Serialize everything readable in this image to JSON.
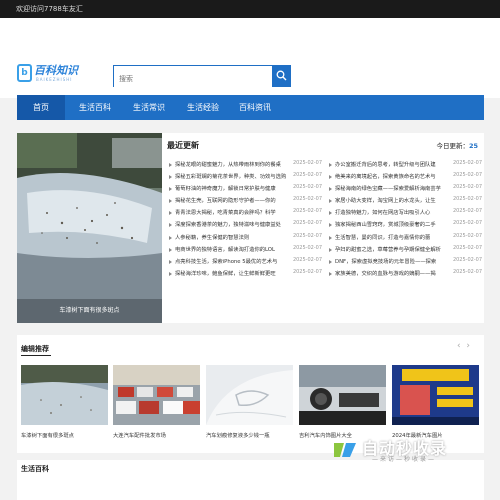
{
  "topbar": {
    "text": "欢迎访问7788车友汇"
  },
  "logo": {
    "mark": "b",
    "name": "百科知识",
    "sub": "BAIKEZHISHI"
  },
  "search": {
    "placeholder": "搜索"
  },
  "nav": [
    "首页",
    "生活百科",
    "生活常识",
    "生活经验",
    "百科资讯"
  ],
  "hero": {
    "caption": "车漆树下面有很多斑点"
  },
  "latest": {
    "title": "最近更新",
    "today_label": "今日更新：",
    "today_count": "25",
    "left": [
      {
        "t": "探秘龙眼的甜蜜魅力，从热带雨林到你的餐桌",
        "d": "2025-02-07"
      },
      {
        "t": "探秘五彩斑斓的菊花茶世界，种类、功效与选购",
        "d": "2025-02-07"
      },
      {
        "t": "葡萄籽油的神奇魔力，解锁日常护肤与健康",
        "d": "2025-02-07"
      },
      {
        "t": "揭秘花生壳，互联网的隐形守护者——你的",
        "d": "2025-02-07"
      },
      {
        "t": "青青法恩大揭秘，吃青菜真的会胖吗？科学",
        "d": "2025-02-07"
      },
      {
        "t": "深度探索香港茶的魅力，独特滋味与健康益处",
        "d": "2025-02-07"
      },
      {
        "t": "人参秘籍，养生保健的智慧法则",
        "d": "2025-02-07"
      },
      {
        "t": "电商世界的独特语言，解读淘打造你的LOL",
        "d": "2025-02-07"
      },
      {
        "t": "点亮科技生活，探索iPhone 5最优的艺术与",
        "d": "2025-02-07"
      },
      {
        "t": "探秘海洋珍味，鲍鱼保鲜，让生鲜新鲜更旺",
        "d": "2025-02-07"
      }
    ],
    "right": [
      {
        "t": "办公室搬迁背后的思考，转型升级与团队建",
        "d": "2025-02-07"
      },
      {
        "t": "绝美来的离境起名，探索黄族命名的艺术与",
        "d": "2025-02-07"
      },
      {
        "t": "探秘海南的绿色宝藏——探索爱解析海南芸芋",
        "d": "2025-02-07"
      },
      {
        "t": "家居小助大变样，淘宝网上的水龙头，让生",
        "d": "2025-02-07"
      },
      {
        "t": "打造独特魅力，如何在网店写出吸引人心",
        "d": "2025-02-07"
      },
      {
        "t": "独家揭秘西山雪窍窍，赏城顶级豪奢的二手",
        "d": "2025-02-07"
      },
      {
        "t": "生活智慧，曼的同识，打造与嘉情你的蕾",
        "d": "2025-02-07"
      },
      {
        "t": "孕妇的甜蜜之选，草莓营养与孕期保健全解析",
        "d": "2025-02-07"
      },
      {
        "t": "DNF，探索虚拟竞技场的元年冒险——探索",
        "d": "2025-02-07"
      },
      {
        "t": "家族美德，交织的血脉与游戏的嫡嗣——揭",
        "d": "2025-02-07"
      }
    ]
  },
  "recommend": {
    "title": "编辑推荐",
    "items": [
      "车漆树下面有很多斑点",
      "大连汽车配件批发市场",
      "汽车划痕修复液多少钱一瓶",
      "吉利汽车内饰图片大全",
      "2024年最新汽车图片"
    ]
  },
  "bottom": {
    "title": "生活百科"
  },
  "watermark": {
    "text": "自动秒收录",
    "sub": "—来访—秒收录—"
  },
  "colors": {
    "primary": "#1f6fc5",
    "nav_active": "#1558a8",
    "topbar": "#1a1a1a"
  }
}
